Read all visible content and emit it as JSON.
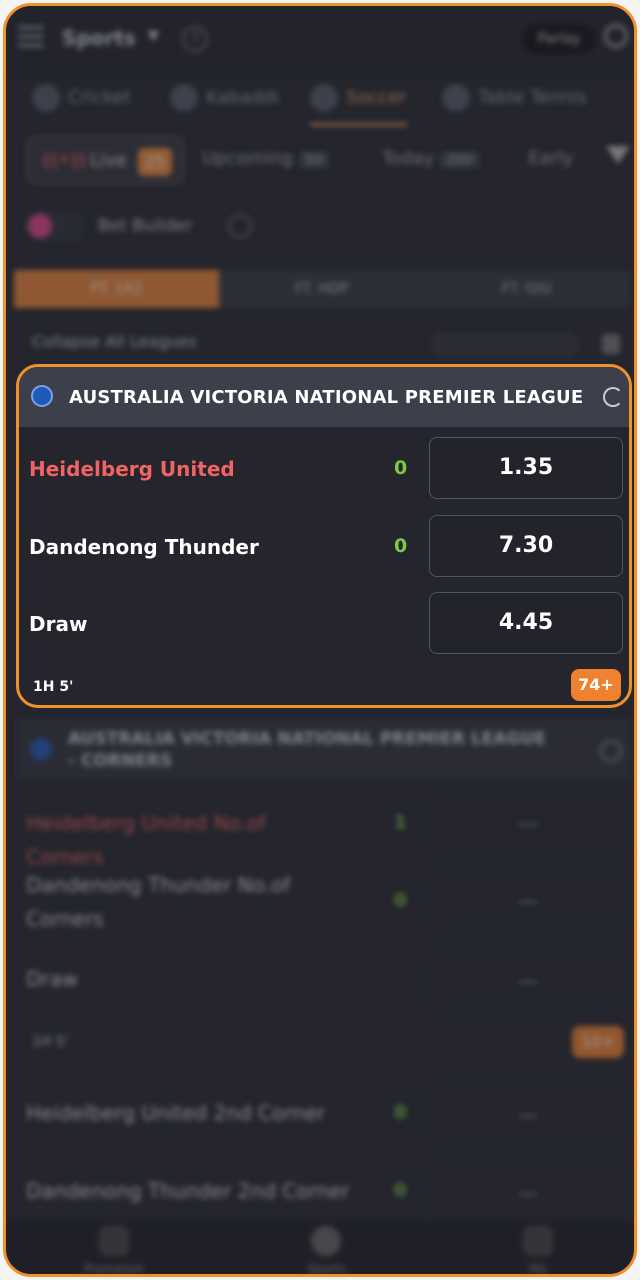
{
  "topbar": {
    "title": "Sports",
    "parlay_label": "Parlay"
  },
  "sport_tabs": [
    "Cricket",
    "Kabaddi",
    "Soccer",
    "Table Tennis"
  ],
  "filters": {
    "live_label": "Live",
    "live_count": "25",
    "upcoming_label": "Upcoming",
    "upcoming_count": "50",
    "today_label": "Today",
    "today_count": "200",
    "early_label": "Early"
  },
  "bet_builder_label": "Bet Builder",
  "market_tabs": [
    "FT. 1X2",
    "FT. HDP",
    "FT. O/U"
  ],
  "collapse_label": "Collapse All Leagues",
  "card": {
    "league_name": "AUSTRALIA VICTORIA NATIONAL PREMIER LEAGUE",
    "rows": [
      {
        "team": "Heidelberg United",
        "score": "0",
        "odds": "1.35"
      },
      {
        "team": "Dandenong Thunder",
        "score": "0",
        "odds": "7.30"
      },
      {
        "team": "Draw",
        "score": "",
        "odds": "4.45"
      }
    ],
    "match_time": "1H 5'",
    "more_markets": "74+"
  },
  "league2": {
    "name": "AUSTRALIA VICTORIA NATIONAL PREMIER LEAGUE - CORNERS",
    "rows": [
      {
        "team": "Heidelberg United No.of Corners",
        "score": "1",
        "odds": "—"
      },
      {
        "team": "Dandenong Thunder No.of Corners",
        "score": "0",
        "odds": "—"
      },
      {
        "team": "Draw",
        "score": "",
        "odds": "—"
      }
    ],
    "match_time": "1H 5'",
    "more_markets": "10+",
    "extra_rows": [
      {
        "team": "Heidelberg United 2nd Corner",
        "score": "0",
        "odds": "—"
      },
      {
        "team": "Dandenong Thunder 2nd Corner",
        "score": "0",
        "odds": "—"
      }
    ]
  },
  "bottom_nav": [
    "Promotion",
    "Sports",
    "Me"
  ]
}
